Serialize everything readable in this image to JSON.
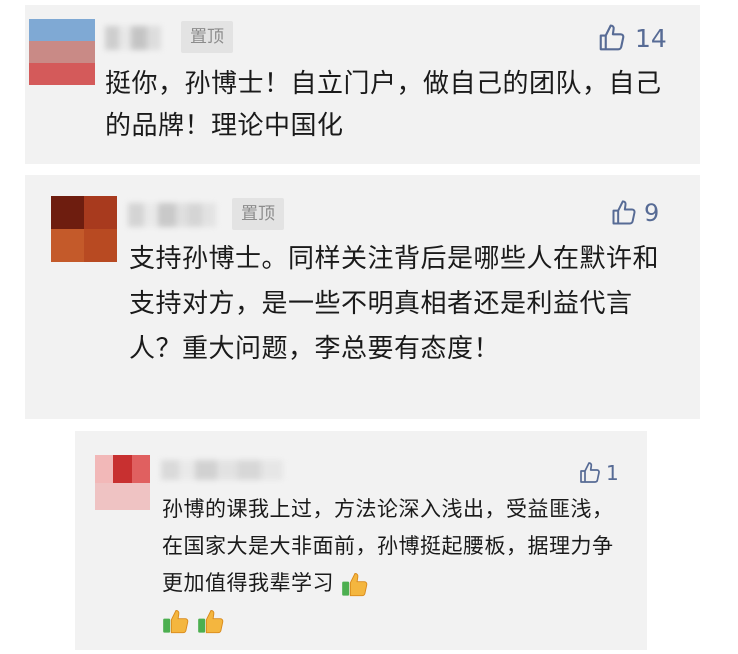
{
  "comments": [
    {
      "pinned_label": "置顶",
      "likes": "14",
      "content": "挺你，孙博士！自立门户，做自己的团队，自己的品牌！理论中国化"
    },
    {
      "pinned_label": "置顶",
      "likes": "9",
      "content": "支持孙博士。同样关注背后是哪些人在默许和支持对方，是一些不明真相者还是利益代言人？重大问题，李总要有态度！"
    }
  ],
  "reply": {
    "likes": "1",
    "content": "孙博的课我上过，方法论深入浅出，受益匪浅，在国家大是大非面前，孙博挺起腰板，据理力争更加值得我辈学习",
    "trailing_emoji": [
      "thumbs-up",
      "thumbs-up",
      "thumbs-up"
    ]
  },
  "colors": {
    "accent": "#576b95",
    "card_bg": "#f2f2f2",
    "pin_bg": "#e3e3e3",
    "emoji_yellow": "#f4b63f",
    "emoji_green": "#4caf50"
  }
}
